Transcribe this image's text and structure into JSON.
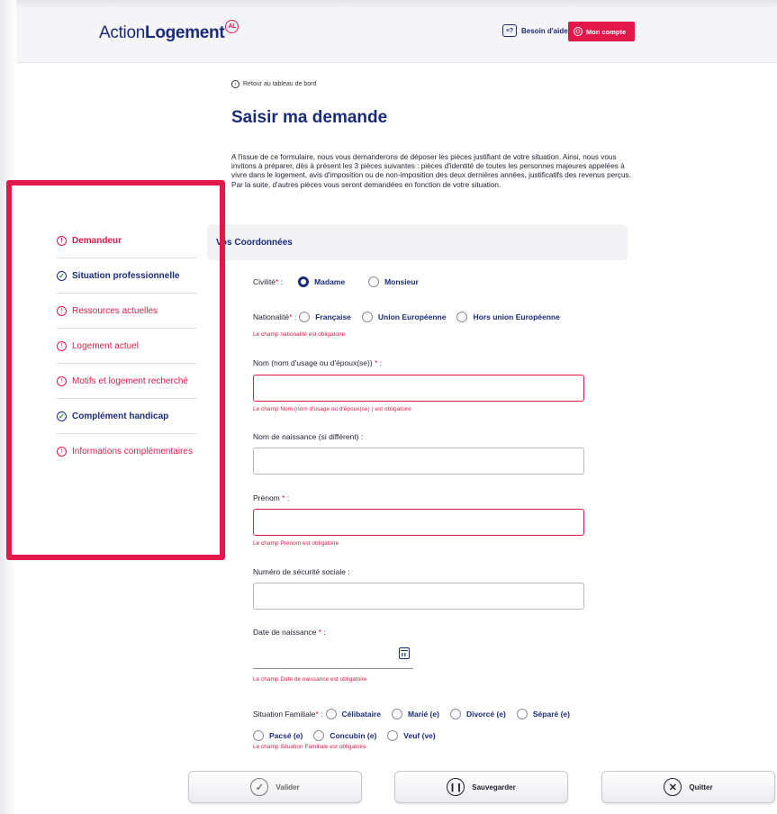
{
  "header": {
    "logo_regular": "Action",
    "logo_bold": "Logement",
    "logo_badge": "AL",
    "help_label": "Besoin d'aide",
    "account_label": "Mon compte"
  },
  "back_link": "Retour au tableau de bord",
  "page_title": "Saisir ma demande",
  "intro_text": "A l'issue de ce formulaire, nous vous demanderons de déposer les pièces justifiant de votre situation. Ainsi, nous vous invitons à préparer, dès à présent les 3 pièces suivantes : pièces d'identité de toutes les personnes majeures appelées à vivre dans le logement, avis d'imposition ou de non-imposition des deux dernières années, justificatifs des revenus perçus. Par la suite, d'autres pièces vous seront demandées en fonction de votre situation.",
  "sidebar": {
    "items": [
      {
        "label": "Demandeur",
        "status": "error"
      },
      {
        "label": "Situation professionnelle",
        "status": "done"
      },
      {
        "label": "Ressources actuelles",
        "status": "error"
      },
      {
        "label": "Logement actuel",
        "status": "error"
      },
      {
        "label": "Motifs et logement recherché",
        "status": "error"
      },
      {
        "label": "Complément handicap",
        "status": "done"
      },
      {
        "label": "Informations complémentaires",
        "status": "error"
      }
    ]
  },
  "section_title": "Vos Coordonnées",
  "form": {
    "civilite": {
      "label": "Civilité",
      "options": [
        "Madame",
        "Monsieur"
      ],
      "selected": "Madame"
    },
    "nationalite": {
      "label": "Nationalité",
      "options": [
        "Française",
        "Union Européenne",
        "Hors union Européenne"
      ],
      "error": "Le champ nationalité est obligatoire"
    },
    "nom": {
      "label": "Nom (nom d'usage ou d'époux(se))",
      "value": "",
      "error": "Le champ Nom (nom d'usage ou d'époux(se) ) est obligatoire"
    },
    "nom_naissance": {
      "label": "Nom de naissance (si différent) :",
      "value": ""
    },
    "prenom": {
      "label": "Prénom",
      "value": "",
      "error": "Le champ Prénom est obligatoire"
    },
    "secu": {
      "label": "Numéro de sécurité sociale :",
      "value": ""
    },
    "date_naissance": {
      "label": "Date de naissance",
      "value": "",
      "error": "Le champ Date de naissance est obligatoire"
    },
    "situation_familiale": {
      "label": "Situation Familiale",
      "options_row1": [
        "Célibataire",
        "Marié (e)",
        "Divorcé (e)",
        "Séparé (e)"
      ],
      "options_row2": [
        "Pacsé (e)",
        "Concubin (e)",
        "Veuf (ve)"
      ],
      "error": "Le champ Situation Familiale est obligatoire"
    },
    "required_mark": "*",
    "label_suffix": " :"
  },
  "footer": {
    "validate": "Valider",
    "save": "Sauvegarder",
    "quit": "Quitter"
  },
  "colors": {
    "brand_navy": "#1a2b7a",
    "brand_red": "#e2184b"
  }
}
